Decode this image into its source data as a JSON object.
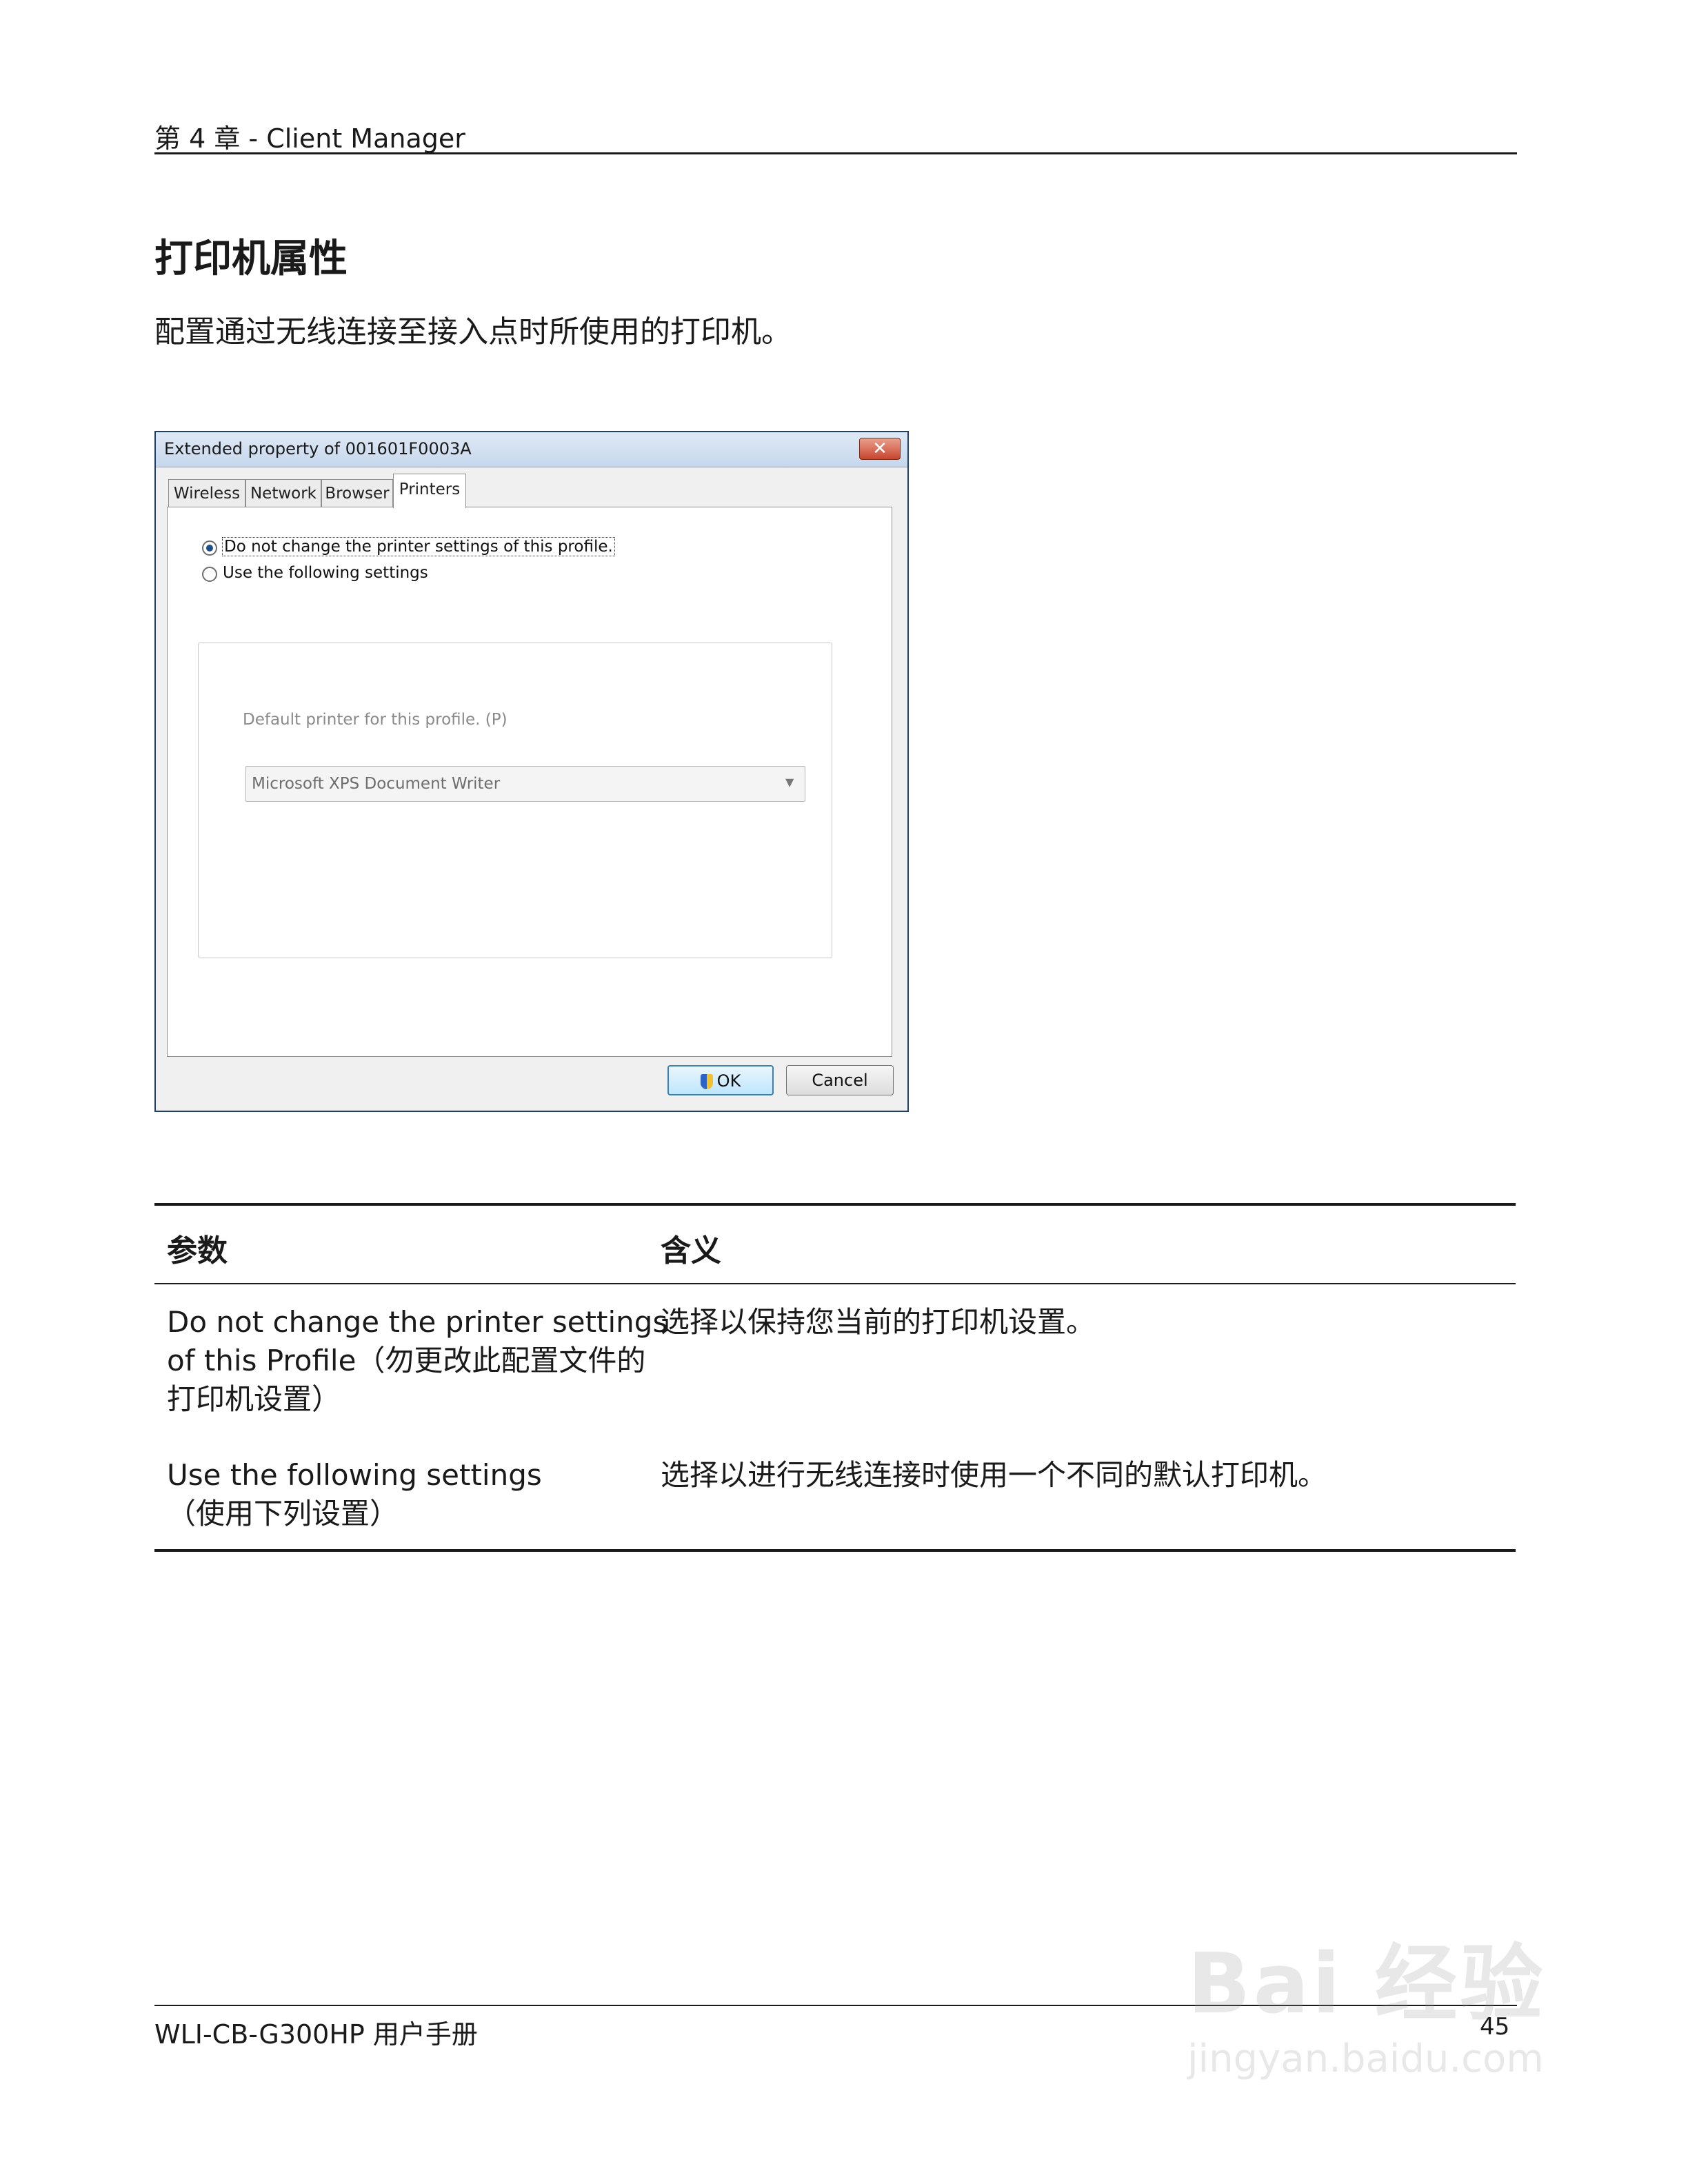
{
  "header": {
    "chapter": "第 4 章 - Client Manager"
  },
  "section": {
    "title": "打印机属性",
    "intro": "配置通过无线连接至接入点时所使用的打印机。"
  },
  "dialog": {
    "title": "Extended property of 001601F0003A",
    "close_glyph": "✕",
    "tabs": [
      "Wireless",
      "Network",
      "Browser",
      "Printers"
    ],
    "active_tab": "Printers",
    "option1": "Do not change the printer settings of this profile.",
    "option2": "Use the following settings",
    "option1_selected": true,
    "default_printer_label": "Default printer for this profile. (P)",
    "default_printer_value": "Microsoft XPS Document Writer",
    "ok_label": "OK",
    "cancel_label": "Cancel"
  },
  "table": {
    "col1": "参数",
    "col2": "含义",
    "rows": [
      {
        "param": [
          "Do not change the printer settings",
          "of this Profile（勿更改此配置文件的",
          "打印机设置）"
        ],
        "meaning": "选择以保持您当前的打印机设置。"
      },
      {
        "param": [
          "Use the following settings",
          "（使用下列设置）"
        ],
        "meaning": "选择以进行无线连接时使用一个不同的默认打印机。"
      }
    ]
  },
  "footer": {
    "manual": "WLI-CB-G300HP 用户手册",
    "page": "45"
  },
  "watermark": {
    "brand": "Bai 经验",
    "url": "jingyan.baidu.com"
  }
}
